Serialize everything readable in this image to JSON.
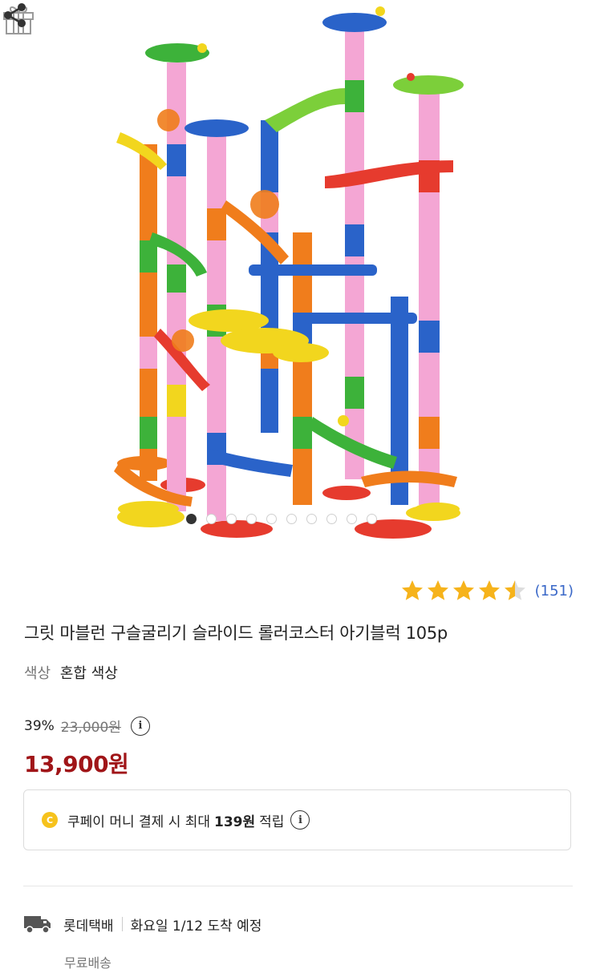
{
  "product": {
    "title": "그릿 마블런 구슬굴리기 슬라이드 롤러코스터 아기블럭 105p",
    "option_label": "색상",
    "option_value": "혼합 색상",
    "image_alt": "marble run toy",
    "gallery": {
      "total_images": 10,
      "active_index": 0
    }
  },
  "rating": {
    "stars": 4.5,
    "review_count": "(151)"
  },
  "price": {
    "discount_rate": "39%",
    "original_price": "23,000원",
    "sale_price": "13,900원",
    "info_icon": "i"
  },
  "reward": {
    "coin_icon": "C",
    "prefix": "쿠페이 머니 결제 시 최대",
    "amount": "139원",
    "suffix": "적립"
  },
  "delivery": {
    "carrier": "롯데택배",
    "eta": "화요일 1/12 도착 예정",
    "shipping_fee": "무료배송"
  },
  "icons": {
    "gift": "gift-icon",
    "share": "share-icon",
    "truck": "truck-icon",
    "info": "info-icon",
    "star": "star-icon"
  },
  "colors": {
    "star": "#f6b31b",
    "price": "#a01518",
    "review_link": "#3a68c8",
    "coin": "#f6c21c"
  }
}
